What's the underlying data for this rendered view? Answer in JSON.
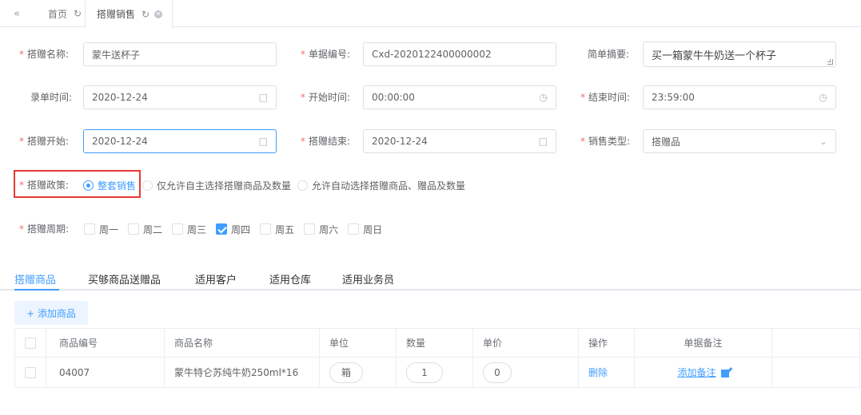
{
  "tabs": {
    "back_icon": "«",
    "items": [
      {
        "label": "首页",
        "icon": "refresh-icon"
      },
      {
        "label": "搭赠销售",
        "icon": "refresh-icon",
        "active": true
      }
    ]
  },
  "form": {
    "name_label": "搭赠名称:",
    "name_value": "蒙牛送杯子",
    "doc_no_label": "单据编号:",
    "doc_no_value": "Cxd-2020122400000002",
    "summary_label": "简单摘要:",
    "summary_value": "买一箱蒙牛牛奶送一个杯子",
    "entry_time_label": "录单时间:",
    "entry_time_value": "2020-12-24",
    "start_time_label": "开始时间:",
    "start_time_value": "00:00:00",
    "end_time_label": "结束时间:",
    "end_time_value": "23:59:00",
    "gift_start_label": "搭赠开始:",
    "gift_start_value": "2020-12-24",
    "gift_end_label": "搭赠结束:",
    "gift_end_value": "2020-12-24",
    "sale_type_label": "销售类型:",
    "sale_type_value": "搭赠品",
    "policy_label": "搭赠政策:",
    "policy_options": [
      "整套销售",
      "仅允许自主选择搭赠商品及数量",
      "允许自动选择搭赠商品、赠品及数量"
    ],
    "period_label": "搭赠周期:",
    "weekdays": [
      "周一",
      "周二",
      "周三",
      "周四",
      "周五",
      "周六",
      "周日"
    ],
    "checked_weekday": "周四"
  },
  "subtabs": [
    "搭赠商品",
    "买够商品送赠品",
    "适用客户",
    "适用仓库",
    "适用业务员"
  ],
  "add_button": "+ 添加商品",
  "table": {
    "headers": [
      "商品编号",
      "商品名称",
      "单位",
      "数量",
      "单价",
      "操作",
      "单据备注"
    ],
    "rows": [
      {
        "code": "04007",
        "name": "蒙牛特仑苏纯牛奶250ml*16",
        "unit": "箱",
        "qty": "1",
        "price": "0",
        "action": "删除",
        "note": "添加备注"
      }
    ]
  },
  "colors": {
    "accent": "#409eff",
    "required": "#f56c6c",
    "highlight_box": "#e53935"
  }
}
